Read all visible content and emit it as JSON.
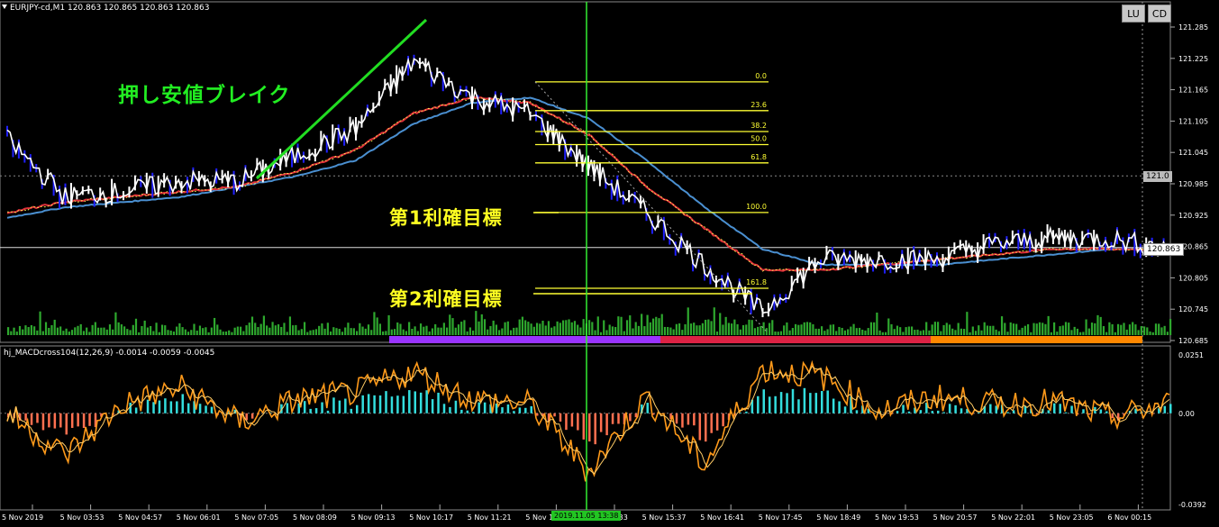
{
  "chart_header": {
    "symbol_text": "EURJPY-cd,M1  120.863 120.865 120.863 120.863"
  },
  "buttons": {
    "lu": "LU",
    "cd": "CD"
  },
  "indicator": {
    "label": "hj_MACDcross104(12,26,9) -0.0014 -0.0059 -0.0045"
  },
  "annotations": {
    "breakout": "押し安値ブレイク",
    "target1": "第1利確目標",
    "target2": "第2利確目標"
  },
  "price_axis": {
    "ticks": [
      "121.285",
      "121.225",
      "121.165",
      "121.105",
      "121.045",
      "120.985",
      "120.925",
      "120.865",
      "120.805",
      "120.745",
      "120.685"
    ],
    "tag_round": "121.0",
    "tag_current": "120.863"
  },
  "macd_axis": {
    "ticks": [
      "0.0251",
      "0.00",
      "-0.0392"
    ]
  },
  "time_axis": {
    "labels": [
      "5 Nov 2019",
      "5 Nov 03:53",
      "5 Nov 04:57",
      "5 Nov 06:01",
      "5 Nov 07:05",
      "5 Nov 08:09",
      "5 Nov 09:13",
      "5 Nov 10:17",
      "5 Nov 11:21",
      "5 Nov 1",
      "5 Nov 14:33",
      "5 Nov 15:37",
      "5 Nov 16:41",
      "5 Nov 17:45",
      "5 Nov 18:49",
      "5 Nov 19:53",
      "5 Nov 20:57",
      "5 Nov 22:01",
      "5 Nov 23:05",
      "6 Nov 00:15"
    ],
    "crosshair_time": "2019.11.05 13:38"
  },
  "fib_levels": [
    {
      "label": "0.0",
      "price": 121.18
    },
    {
      "label": "23.6",
      "price": 121.125
    },
    {
      "label": "38.2",
      "price": 121.085
    },
    {
      "label": "50.0",
      "price": 121.06
    },
    {
      "label": "61.8",
      "price": 121.025
    },
    {
      "label": "100.0",
      "price": 120.93
    },
    {
      "label": "161.8",
      "price": 120.785
    }
  ],
  "colors": {
    "price_line": "#ffffff",
    "candle_up": "#ffffff",
    "candle_down": "#2020ff",
    "ma_fast": "#e0303a",
    "ma_slow": "#4a8fd0",
    "fib": "#ffff33",
    "breakout_line": "#22dd22",
    "crosshair": "#33ee33",
    "volume": "#2ea82e",
    "macd_main": "#ff9a1a",
    "macd_hist_pos": "#33dddd",
    "macd_hist_neg": "#ff7050",
    "session_bar": [
      "#9a33ff",
      "#dd2244",
      "#ff8800"
    ]
  },
  "chart_data": {
    "type": "line",
    "symbol": "EURJPY-cd",
    "timeframe": "M1",
    "ylim": [
      120.685,
      121.285
    ],
    "x": [
      "5 Nov 2019",
      "5 Nov 03:53",
      "5 Nov 04:57",
      "5 Nov 06:01",
      "5 Nov 07:05",
      "5 Nov 08:09",
      "5 Nov 09:13",
      "5 Nov 10:17",
      "5 Nov 11:21",
      "5 Nov 12:29",
      "5 Nov 13:38",
      "5 Nov 14:33",
      "5 Nov 15:37",
      "5 Nov 16:41",
      "5 Nov 17:45",
      "5 Nov 18:49",
      "5 Nov 19:53",
      "5 Nov 20:57",
      "5 Nov 22:01",
      "5 Nov 23:05",
      "6 Nov 00:15"
    ],
    "series": [
      {
        "values": [
          121.07,
          120.96,
          120.97,
          120.99,
          120.99,
          121.04,
          121.09,
          121.22,
          121.15,
          121.12,
          121.02,
          120.93,
          120.83,
          120.74,
          120.84,
          120.84,
          120.84,
          120.87,
          120.88,
          120.88,
          120.86
        ]
      },
      {
        "values": [
          120.93,
          120.95,
          120.96,
          120.97,
          120.98,
          121.01,
          121.05,
          121.12,
          121.15,
          121.14,
          121.08,
          120.98,
          120.9,
          120.82,
          120.82,
          120.83,
          120.84,
          120.85,
          120.86,
          120.86,
          120.86
        ]
      },
      {
        "values": [
          120.92,
          120.94,
          120.95,
          120.96,
          120.98,
          121.0,
          121.03,
          121.1,
          121.14,
          121.15,
          121.11,
          121.03,
          120.94,
          120.86,
          120.83,
          120.83,
          120.83,
          120.84,
          120.85,
          120.86,
          120.86
        ]
      }
    ],
    "macd": {
      "ylim": [
        -0.0392,
        0.0251
      ],
      "values": [
        0.0,
        -0.018,
        0.004,
        0.011,
        -0.004,
        0.006,
        0.009,
        0.018,
        0.006,
        0.004,
        -0.025,
        0.007,
        -0.022,
        0.019,
        0.016,
        0.001,
        0.007,
        0.004,
        0.005,
        -0.002,
        0.004
      ]
    }
  }
}
